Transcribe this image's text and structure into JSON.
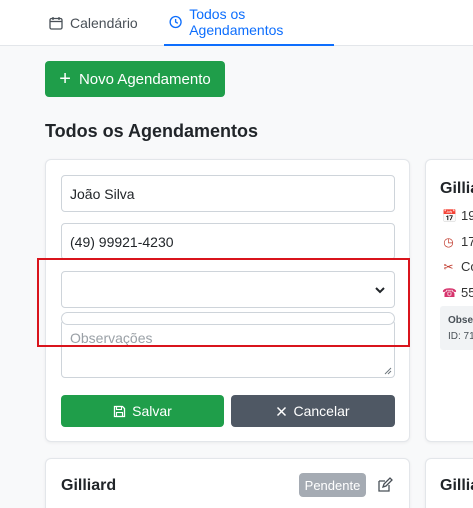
{
  "tabs": [
    {
      "label": "Calendário",
      "icon": "calendar-icon",
      "active": false
    },
    {
      "label": "Todos os Agendamentos",
      "icon": "clock-icon",
      "active": true
    }
  ],
  "actions": {
    "new_appointment": "Novo Agendamento"
  },
  "page": {
    "title": "Todos os Agendamentos"
  },
  "form": {
    "name_value": "João Silva",
    "phone_value": "(49) 99921-4230",
    "service_value": "",
    "notes_placeholder": "Observações",
    "save_label": "Salvar",
    "cancel_label": "Cancelar"
  },
  "side_card": {
    "name": "Gillia",
    "rows": [
      {
        "icon": "calendar-icon",
        "text": "19"
      },
      {
        "icon": "clock-icon",
        "text": "17"
      },
      {
        "icon": "scissors-icon",
        "text": "Co"
      },
      {
        "icon": "phone-icon",
        "text": "55"
      }
    ],
    "obs_label": "Obse",
    "obs_id": "ID: 71"
  },
  "bottom_card": {
    "name": "Gilliard",
    "status": "Pendente"
  },
  "bottom_side_card": {
    "name": "Gillia"
  },
  "colors": {
    "primary": "#0d6efd",
    "success": "#1f9e4a",
    "secondary": "#4f5864",
    "badge": "#a5abb3",
    "highlight": "#d9141c"
  }
}
